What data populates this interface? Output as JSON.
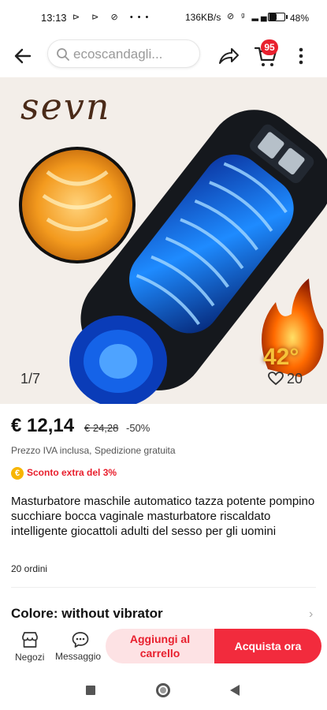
{
  "status_bar": {
    "time": "13:13",
    "left_icons": "⊳ ⊳ ⊘ •••",
    "net_speed": "136KB/s",
    "battery_pct": "48%",
    "battery_level": 0.48
  },
  "topbar": {
    "search_text": "ecoscandagli...",
    "cart_count": "95"
  },
  "gallery": {
    "brand": "sevn",
    "temperature": "42°",
    "counter": "1/7",
    "favorites": "20"
  },
  "product": {
    "price": "€ 12,14",
    "old_price": "€ 24,28",
    "discount": "-50%",
    "tax_note": "Prezzo IVA inclusa, Spedizione gratuita",
    "extra_discount": "Sconto extra del 3%",
    "title": "Masturbatore maschile automatico tazza potente pompino succhiare bocca vaginale masturbatore riscaldato intelligente giocattoli adulti del sesso per gli uomini",
    "orders": "20 ordini",
    "color_label": "Colore: without vibrator"
  },
  "bottom_bar": {
    "store_label": "Negozi",
    "message_label": "Messaggio",
    "add_to_cart": "Aggiungi al carrello",
    "buy_now": "Acquista ora"
  },
  "colors": {
    "accent_red": "#f22b3d",
    "badge_red": "#e8202e",
    "add_cart_bg": "#fde2e4"
  }
}
